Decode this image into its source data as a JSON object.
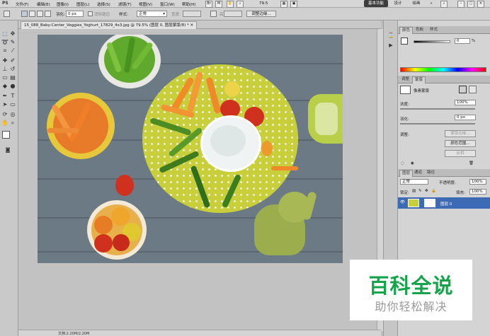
{
  "menubar": {
    "app_logo": "PS",
    "items": [
      "文件(F)",
      "编辑(E)",
      "图像(I)",
      "图层(L)",
      "选择(S)",
      "滤镜(T)",
      "视图(V)",
      "窗口(W)",
      "帮助(H)"
    ],
    "zoom": "79.5",
    "workspaces": [
      "基本功能",
      "设计",
      "绘画"
    ],
    "workspace_more": "»"
  },
  "options": {
    "feather_label": "羽化:",
    "feather_value": "0 px",
    "antialias_label": "消除锯齿",
    "style_label": "样式:",
    "style_value": "正常",
    "width_label": "宽度:",
    "height_label": "高度:",
    "refine_edge": "调整边缘..."
  },
  "document": {
    "tab_title": "15_088_Baby-Center_Veggies_Yoghurt_17829_4x3.jpg @ 79.5% (图层 0, 图层蒙版/8) *",
    "status": "文档:2.20M/2.20M"
  },
  "color_panel": {
    "tabs": [
      "颜色",
      "色板",
      "样式"
    ],
    "slider_value": "0",
    "unit": "%"
  },
  "mask_panel": {
    "tabs": [
      "调整",
      "蒙版"
    ],
    "mask_type": "像素蒙版",
    "density_label": "浓度:",
    "density_value": "100%",
    "feather_label": "羽化:",
    "feather_value": "0 px",
    "adjust_label": "调整:",
    "buttons": [
      "蒙版边缘...",
      "颜色范围...",
      "反相"
    ]
  },
  "layers_panel": {
    "tabs": [
      "图层",
      "通道",
      "路径"
    ],
    "blend_mode": "正常",
    "opacity_label": "不透明度:",
    "opacity_value": "100%",
    "lock_label": "锁定:",
    "fill_label": "填充:",
    "fill_value": "100%",
    "layer_name": "图层 0"
  },
  "watermark": {
    "title": "百科全说",
    "subtitle": "助你轻松解决"
  },
  "colors": {
    "accent_green": "#16a44a",
    "plate_yellow": "#c8cf3a",
    "wood": "#6b7a84"
  }
}
